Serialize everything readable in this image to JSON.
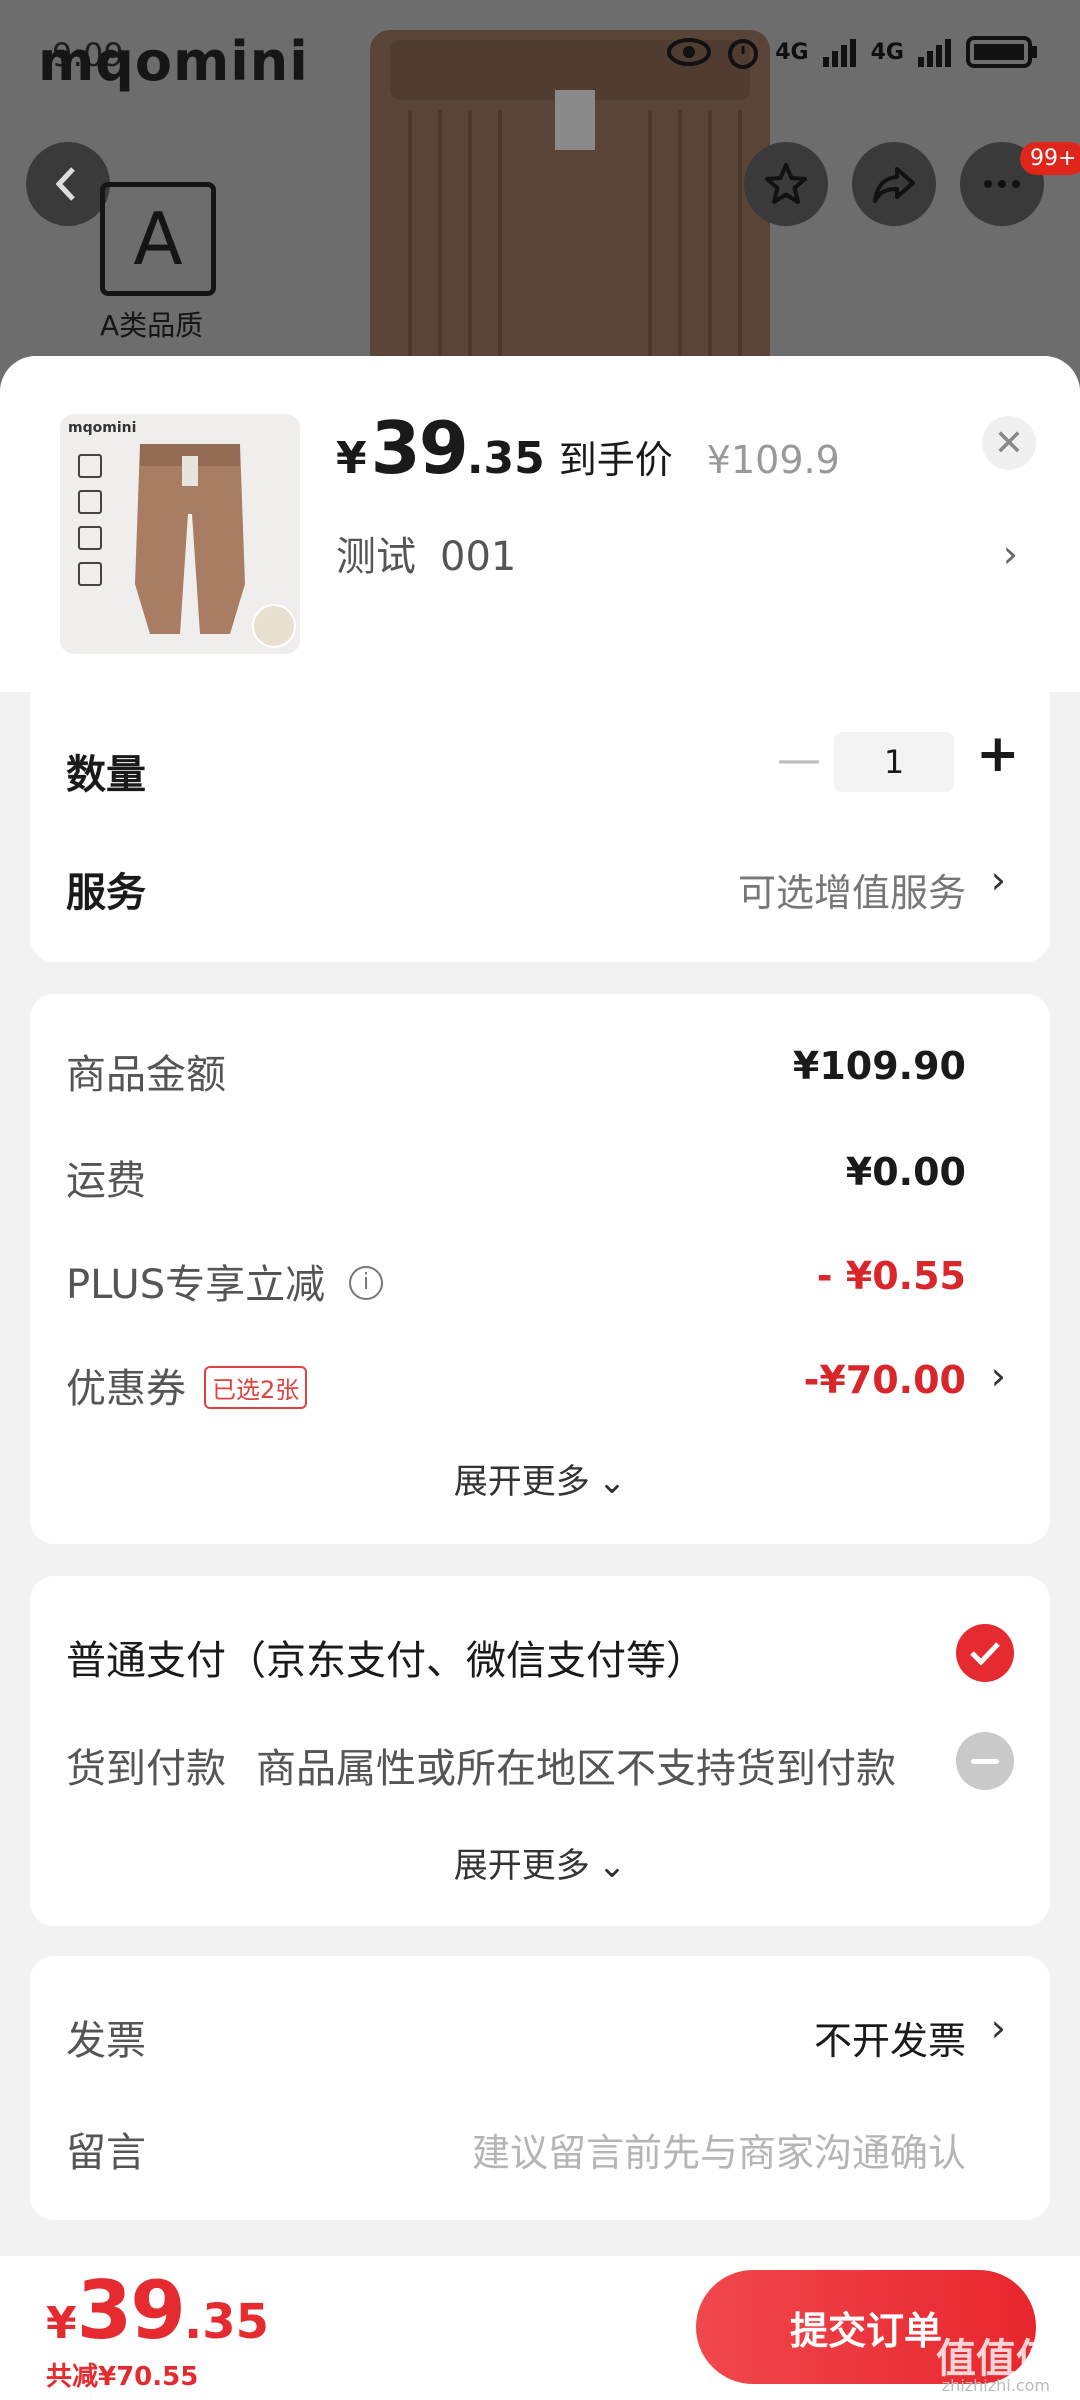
{
  "background": {
    "brand_logo": "mqomini",
    "status_time": "9:09",
    "quality_letter": "A",
    "quality_text": "A类品质",
    "badge": "99+",
    "network_1": "4G",
    "network_2": "4G"
  },
  "product": {
    "price_currency": "¥",
    "price_integer": "39",
    "price_decimal": ".35",
    "price_label": "到手价",
    "original_price": "¥109.9",
    "spec_name": "测试",
    "spec_code": "001",
    "close_symbol": "✕",
    "thumb_logo": "mqomini"
  },
  "quantity": {
    "label": "数量",
    "minus": "—",
    "value": "1",
    "plus": "+"
  },
  "service": {
    "label": "服务",
    "value": "可选增值服务"
  },
  "costs": {
    "goods_label": "商品金额",
    "goods_value": "¥109.90",
    "shipping_label": "运费",
    "shipping_value": "¥0.00",
    "plus_label": "PLUS专享立减",
    "plus_value": "- ¥0.55",
    "coupon_label": "优惠券",
    "coupon_tag": "已选2张",
    "coupon_value": "-¥70.00",
    "expand": "展开更多"
  },
  "payment": {
    "normal_label": "普通支付（京东支付、微信支付等）",
    "cod_label": "货到付款",
    "cod_note": "商品属性或所在地区不支持货到付款",
    "expand": "展开更多"
  },
  "misc": {
    "invoice_label": "发票",
    "invoice_value": "不开发票",
    "message_label": "留言",
    "message_placeholder": "建议留言前先与商家沟通确认"
  },
  "bottom": {
    "currency": "¥",
    "integer": "39",
    "decimal": ".35",
    "saved": "共减¥70.55",
    "submit": "提交订单",
    "watermark": "值值值",
    "watermark_url": "zhizhizhi.com"
  },
  "colors": {
    "accent_red": "#e52b2f",
    "price_red": "#d8262a"
  }
}
